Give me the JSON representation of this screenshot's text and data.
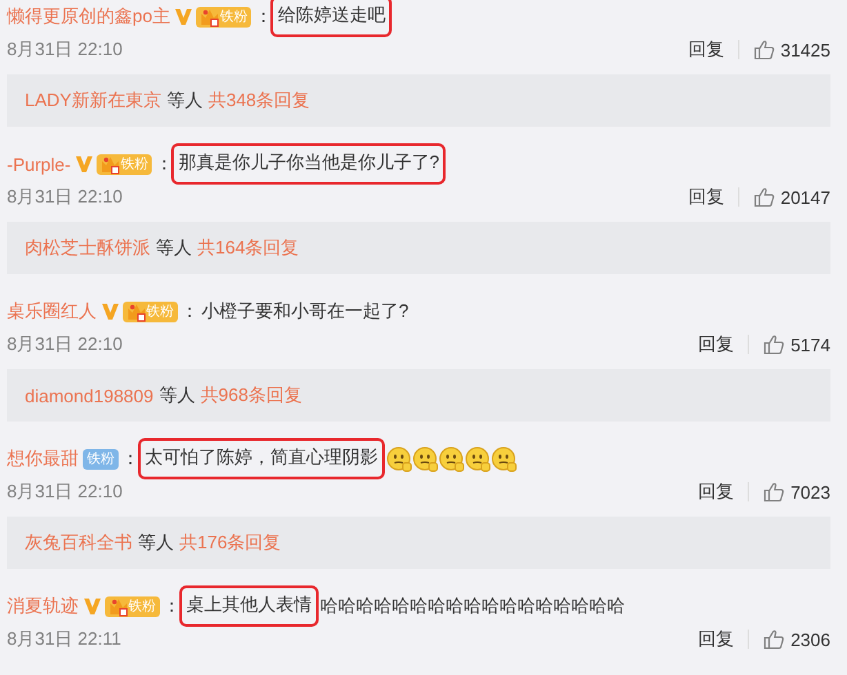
{
  "comments": [
    {
      "user": "懒得更原创的鑫po主",
      "verified": true,
      "badge": {
        "kind": "fan_gold",
        "label": "铁粉"
      },
      "separator": "：",
      "text": [
        {
          "t": "给陈婷送走吧",
          "highlighted": true
        }
      ],
      "time": "8月31日 22:10",
      "reply": "回复",
      "likes": "31425",
      "replies": {
        "users": "LADY新新在東京",
        "others": "等人",
        "total": "共348条回复"
      }
    },
    {
      "user": "-Purple-",
      "verified": true,
      "badge": {
        "kind": "fan_gold",
        "label": "铁粉"
      },
      "separator": "：",
      "text": [
        {
          "t": "那真是你儿子你当他是你儿子了?",
          "highlighted": true
        }
      ],
      "time": "8月31日 22:10",
      "reply": "回复",
      "likes": "20147",
      "replies": {
        "users": "肉松芝士酥饼派",
        "others": "等人",
        "total": "共164条回复"
      }
    },
    {
      "user": "桌乐圈红人",
      "verified": true,
      "badge": {
        "kind": "fan_gold",
        "label": "铁粉"
      },
      "separator": "：",
      "text": [
        {
          "t": "小橙子要和小哥在一起了?",
          "highlighted": false
        }
      ],
      "time": "8月31日 22:10",
      "reply": "回复",
      "likes": "5174",
      "replies": {
        "users": "diamond198809",
        "others": "等人",
        "total": "共968条回复"
      }
    },
    {
      "user": "想你最甜",
      "verified": false,
      "badge": {
        "kind": "fan_blue",
        "label": "铁粉"
      },
      "separator": "：",
      "text": [
        {
          "t": "太可怕了陈婷，简直心理阴影",
          "highlighted": true
        }
      ],
      "emojis": [
        {
          "kind": "thinking"
        },
        {
          "kind": "thinking"
        },
        {
          "kind": "thinking"
        },
        {
          "kind": "thinking"
        },
        {
          "kind": "thinking"
        }
      ],
      "time": "8月31日 22:10",
      "reply": "回复",
      "likes": "7023",
      "replies": {
        "users": "灰兔百科全书",
        "others": "等人",
        "total": "共176条回复"
      }
    },
    {
      "user": "消夏轨迹",
      "verified": true,
      "badge": {
        "kind": "fan_gold",
        "label": "铁粉"
      },
      "separator": "：",
      "text": [
        {
          "t": "桌上其他人表情",
          "highlighted": true
        },
        {
          "t": "哈哈哈哈哈哈哈哈哈哈哈哈哈哈哈哈哈",
          "highlighted": false
        }
      ],
      "time": "8月31日 22:11",
      "reply": "回复",
      "likes": "2306"
    }
  ]
}
